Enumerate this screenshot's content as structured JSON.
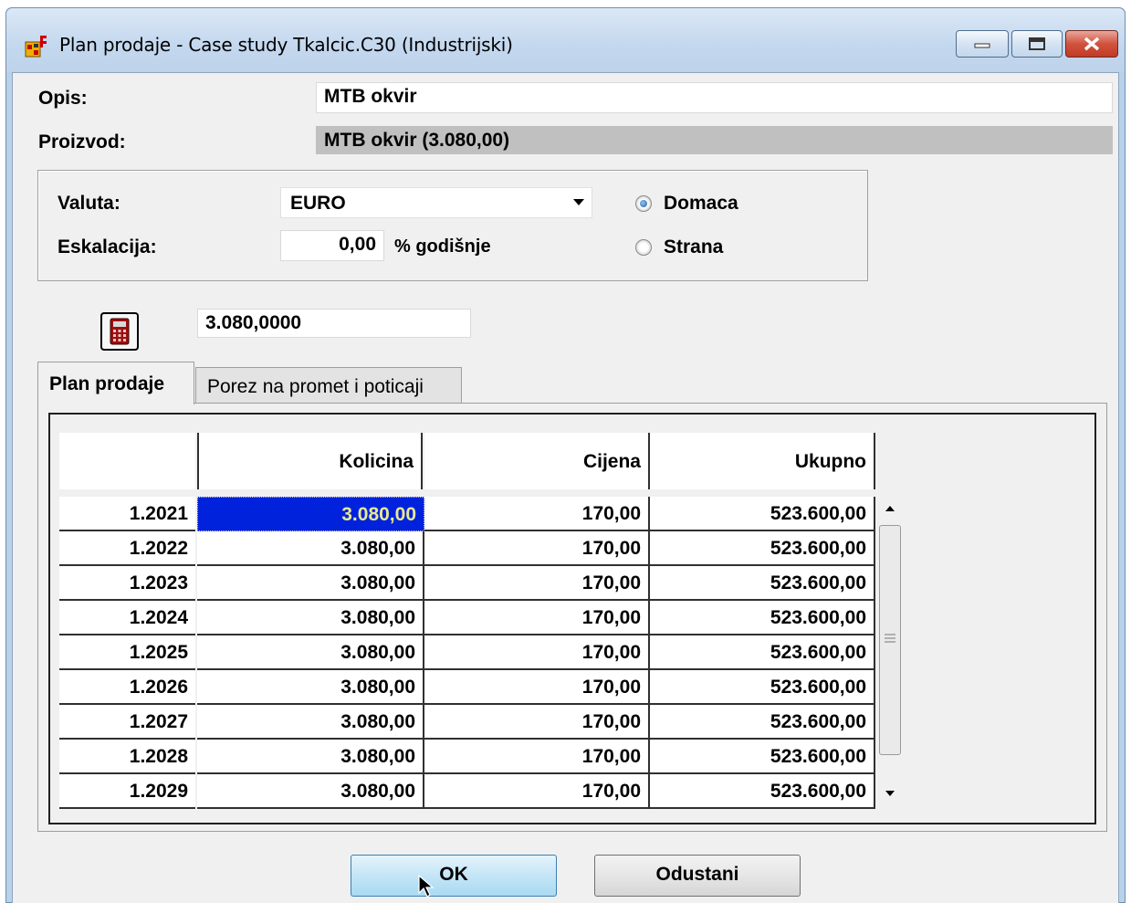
{
  "window": {
    "title": "Plan prodaje - Case study Tkalcic.C30 (Industrijski)"
  },
  "form": {
    "opis_label": "Opis:",
    "opis_value": "MTB okvir",
    "proizvod_label": "Proizvod:",
    "proizvod_value": "MTB okvir (3.080,00)"
  },
  "currency": {
    "valuta_label": "Valuta:",
    "valuta_value": "EURO",
    "eskalacija_label": "Eskalacija:",
    "eskalacija_value": "0,00",
    "eskalacija_unit": "% godišnje",
    "radio_domestic": "Domaca",
    "radio_foreign": "Strana",
    "selected": "Domaca"
  },
  "calc": {
    "value": "3.080,0000",
    "icon": "calculator-icon"
  },
  "tabs": [
    {
      "label": "Plan prodaje",
      "active": true
    },
    {
      "label": "Porez na promet i poticaji",
      "active": false
    }
  ],
  "table": {
    "columns": [
      "",
      "Kolicina",
      "Cijena",
      "Ukupno"
    ],
    "rows": [
      {
        "period": "1.2021",
        "kolicina": "3.080,00",
        "cijena": "170,00",
        "ukupno": "523.600,00"
      },
      {
        "period": "1.2022",
        "kolicina": "3.080,00",
        "cijena": "170,00",
        "ukupno": "523.600,00"
      },
      {
        "period": "1.2023",
        "kolicina": "3.080,00",
        "cijena": "170,00",
        "ukupno": "523.600,00"
      },
      {
        "period": "1.2024",
        "kolicina": "3.080,00",
        "cijena": "170,00",
        "ukupno": "523.600,00"
      },
      {
        "period": "1.2025",
        "kolicina": "3.080,00",
        "cijena": "170,00",
        "ukupno": "523.600,00"
      },
      {
        "period": "1.2026",
        "kolicina": "3.080,00",
        "cijena": "170,00",
        "ukupno": "523.600,00"
      },
      {
        "period": "1.2027",
        "kolicina": "3.080,00",
        "cijena": "170,00",
        "ukupno": "523.600,00"
      },
      {
        "period": "1.2028",
        "kolicina": "3.080,00",
        "cijena": "170,00",
        "ukupno": "523.600,00"
      },
      {
        "period": "1.2029",
        "kolicina": "3.080,00",
        "cijena": "170,00",
        "ukupno": "523.600,00"
      }
    ]
  },
  "buttons": {
    "ok": "OK",
    "cancel": "Odustani"
  },
  "colors": {
    "selection": "#0022dd",
    "ok_button": "#c4e5f6",
    "close_button": "#c23b25"
  }
}
